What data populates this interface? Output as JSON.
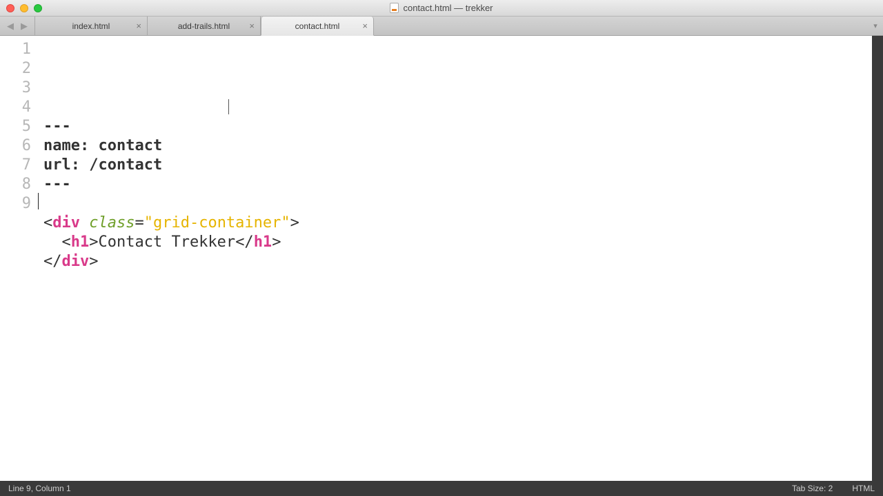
{
  "window": {
    "title": "contact.html — trekker"
  },
  "tabs": [
    {
      "label": "index.html",
      "active": false
    },
    {
      "label": "add-trails.html",
      "active": false
    },
    {
      "label": "contact.html",
      "active": true
    }
  ],
  "code": {
    "lines": [
      {
        "num": "1",
        "tokens": [
          {
            "t": "---",
            "c": "bold plain"
          }
        ]
      },
      {
        "num": "2",
        "tokens": [
          {
            "t": "name: contact",
            "c": "bold plain"
          }
        ]
      },
      {
        "num": "3",
        "tokens": [
          {
            "t": "url: /contact",
            "c": "bold plain"
          }
        ]
      },
      {
        "num": "4",
        "tokens": [
          {
            "t": "---",
            "c": "bold plain"
          }
        ]
      },
      {
        "num": "5",
        "tokens": [
          {
            "t": "",
            "c": "plain"
          }
        ]
      },
      {
        "num": "6",
        "tokens": [
          {
            "t": "<",
            "c": "punct"
          },
          {
            "t": "div",
            "c": "tag"
          },
          {
            "t": " ",
            "c": "plain"
          },
          {
            "t": "class",
            "c": "attr"
          },
          {
            "t": "=",
            "c": "punct"
          },
          {
            "t": "\"grid-container\"",
            "c": "str"
          },
          {
            "t": ">",
            "c": "punct"
          }
        ]
      },
      {
        "num": "7",
        "tokens": [
          {
            "t": "  ",
            "c": "plain"
          },
          {
            "t": "<",
            "c": "punct"
          },
          {
            "t": "h1",
            "c": "tag"
          },
          {
            "t": ">",
            "c": "punct"
          },
          {
            "t": "Contact Trekker",
            "c": "plain"
          },
          {
            "t": "</",
            "c": "punct"
          },
          {
            "t": "h1",
            "c": "tag"
          },
          {
            "t": ">",
            "c": "punct"
          }
        ]
      },
      {
        "num": "8",
        "tokens": [
          {
            "t": "</",
            "c": "punct"
          },
          {
            "t": "div",
            "c": "tag"
          },
          {
            "t": ">",
            "c": "punct"
          }
        ]
      },
      {
        "num": "9",
        "tokens": [
          {
            "t": "",
            "c": "plain"
          }
        ]
      }
    ]
  },
  "status": {
    "left": "Line 9, Column 1",
    "tab_size": "Tab Size: 2",
    "syntax": "HTML"
  }
}
